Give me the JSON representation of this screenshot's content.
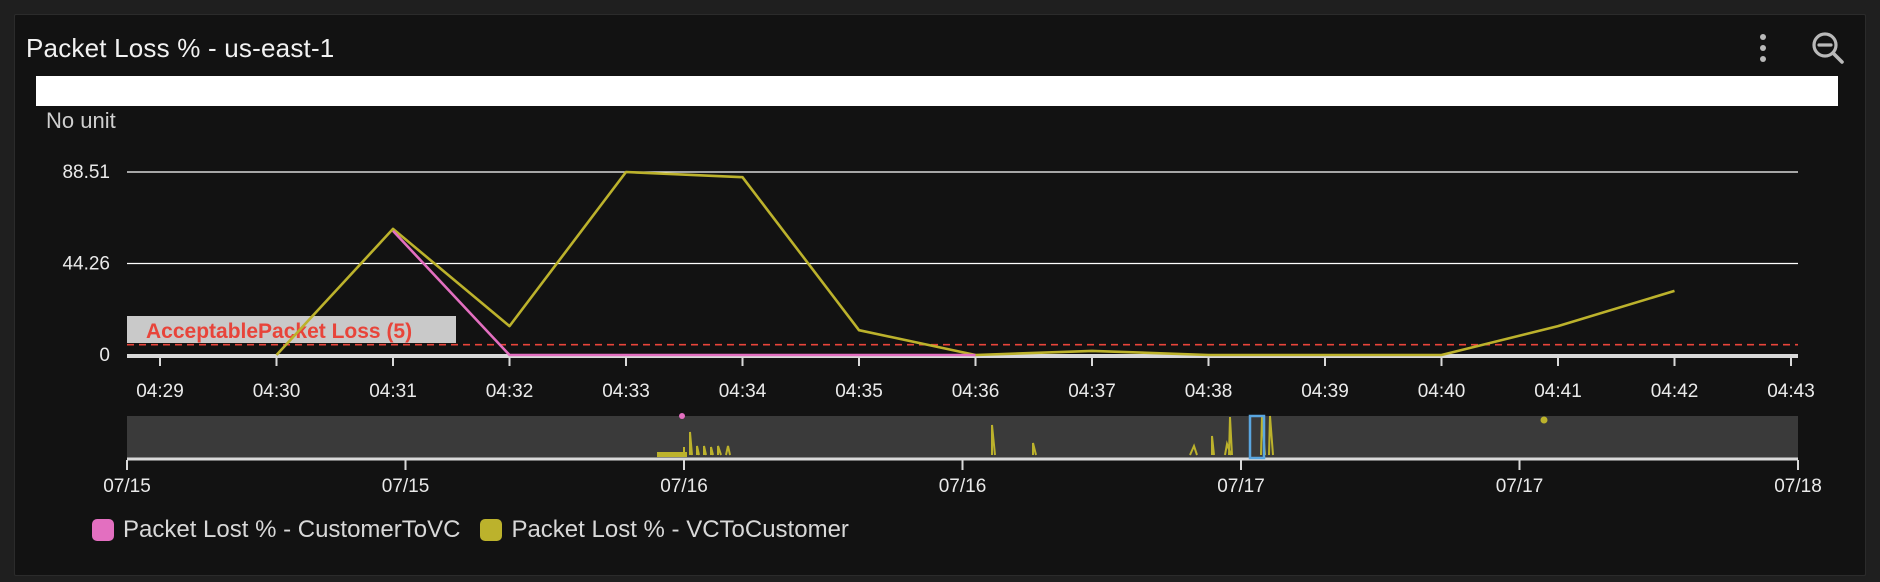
{
  "widget": {
    "title": "Packet Loss % - us-east-1",
    "unit_label": "No unit",
    "menu_icon": "vertical-ellipsis-icon",
    "zoom_icon": "zoom-out-icon"
  },
  "colors": {
    "customer_to_vc": "#e36fc0",
    "vc_to_customer": "#bcb22c",
    "threshold": "#e8443a",
    "threshold_bg": "#c9c9c9",
    "grid": "#ffffff"
  },
  "chart_data": {
    "type": "line",
    "x": [
      "04:29",
      "04:30",
      "04:31",
      "04:32",
      "04:33",
      "04:34",
      "04:35",
      "04:36",
      "04:37",
      "04:38",
      "04:39",
      "04:40",
      "04:41",
      "04:42",
      "04:43"
    ],
    "yticks": [
      "0",
      "44.26",
      "88.51"
    ],
    "ytick_values": [
      0,
      44.26,
      88.51
    ],
    "ylim": [
      0,
      88.51
    ],
    "series": [
      {
        "name": "Packet Lost % - CustomerToVC",
        "color": "#e36fc0",
        "values": [
          null,
          null,
          60,
          0,
          0,
          0,
          0,
          0,
          null,
          null,
          null,
          null,
          null,
          null,
          null
        ]
      },
      {
        "name": "Packet Lost % - VCToCustomer",
        "color": "#bcb22c",
        "values": [
          null,
          0,
          61,
          14,
          88.51,
          86,
          12,
          0,
          2,
          0,
          0,
          0,
          14,
          31,
          null
        ]
      }
    ],
    "threshold": {
      "label": "AcceptablePacket Loss (5)",
      "value": 5
    },
    "overview": {
      "labels": [
        "07/15",
        "07/15",
        "07/16",
        "07/16",
        "07/17",
        "07/17",
        "07/18"
      ]
    },
    "legend": [
      "Packet Lost % - CustomerToVC",
      "Packet Lost % - VCToCustomer"
    ]
  }
}
